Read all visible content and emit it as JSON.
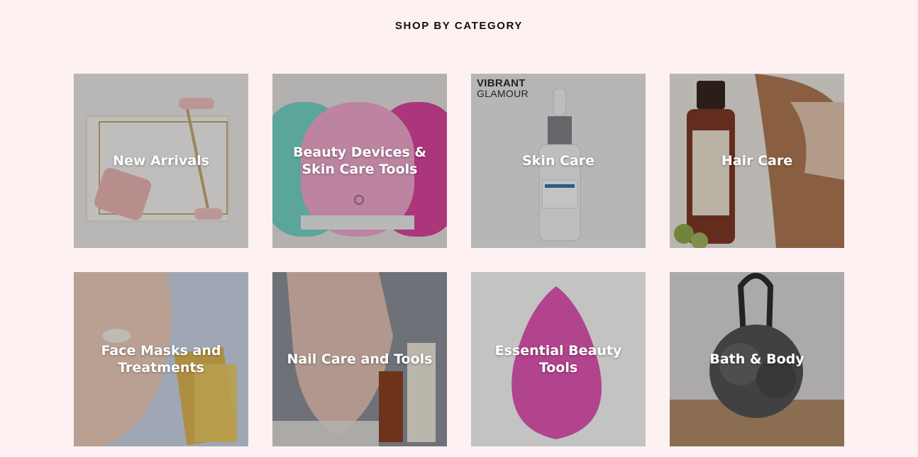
{
  "section": {
    "title": "SHOP BY CATEGORY"
  },
  "categories": [
    {
      "label": "New Arrivals"
    },
    {
      "label": "Beauty Devices & Skin Care Tools"
    },
    {
      "label": "Skin Care"
    },
    {
      "label": "Hair Care"
    },
    {
      "label": "Face Masks and Treatments"
    },
    {
      "label": "Nail Care and Tools"
    },
    {
      "label": "Essential Beauty Tools"
    },
    {
      "label": "Bath & Body"
    }
  ],
  "skin_care_image": {
    "brand_line1": "VIBRANT",
    "brand_line2": "GLAMOUR"
  },
  "colors": {
    "background": "#fdf2f1",
    "overlay": "rgba(40,40,40,0.28)",
    "label": "#ffffff"
  }
}
